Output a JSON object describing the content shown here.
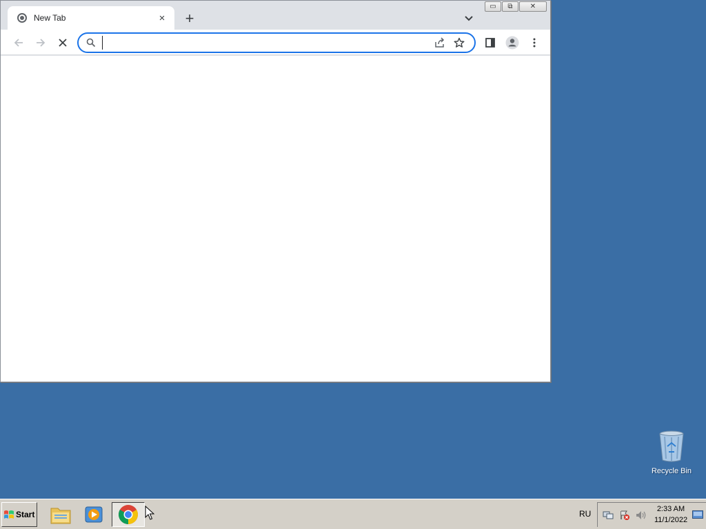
{
  "browser": {
    "tab": {
      "title": "New Tab",
      "close_glyph": "×",
      "favicon": "chrome-newtab-icon"
    },
    "newtab_glyph": "+",
    "window_controls": {
      "minimize": "▭",
      "restore": "⧉",
      "close": "✕"
    },
    "toolbar": {
      "back_icon": "arrow-left-icon",
      "forward_icon": "arrow-right-icon",
      "stop_icon": "close-icon",
      "omnibox": {
        "value": "",
        "placeholder": ""
      },
      "share_icon": "share-icon",
      "bookmark_icon": "star-icon",
      "sidepanel_icon": "side-panel-icon",
      "profile_icon": "person-icon",
      "menu_icon": "three-dots-vertical-icon"
    }
  },
  "desktop": {
    "icons": [
      {
        "label": "Recycle Bin",
        "icon": "recycle-bin-icon"
      }
    ]
  },
  "taskbar": {
    "start_label": "Start",
    "apps": [
      {
        "name": "file-explorer",
        "icon": "folder-icon"
      },
      {
        "name": "media-player",
        "icon": "media-player-icon"
      },
      {
        "name": "chrome",
        "icon": "chrome-icon",
        "active": true
      }
    ],
    "language": "RU",
    "clock": {
      "time": "2:33 AM",
      "date": "11/1/2022"
    }
  },
  "colors": {
    "desktop_bg": "#3a6ea5",
    "omnibox_focus": "#1a73e8",
    "taskbar_bg": "#d4d0c8"
  }
}
